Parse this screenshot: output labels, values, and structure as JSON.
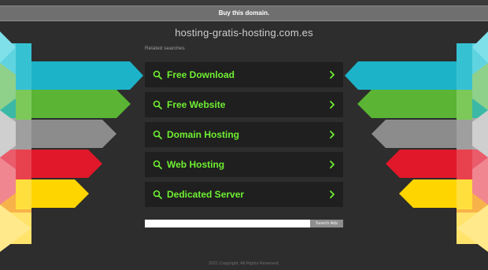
{
  "buy_bar": {
    "label": "Buy this domain."
  },
  "domain": {
    "title": "hosting-gratis-hosting.com.es"
  },
  "related": {
    "label": "Related searches",
    "items": [
      {
        "label": "Free Download"
      },
      {
        "label": "Free Website"
      },
      {
        "label": "Domain Hosting"
      },
      {
        "label": "Web Hosting"
      },
      {
        "label": "Dedicated Server"
      }
    ]
  },
  "search": {
    "value": "",
    "placeholder": "",
    "button_label": "Search Ads"
  },
  "footer": {
    "copyright": "2021 Copyright. All Rights Reserved."
  },
  "colors": {
    "background": "#2d2d2d",
    "link_text": "#6ff032",
    "link_bg": "#1f1f1f",
    "stripe_cyan": "#1cb3c8",
    "stripe_green": "#5bb434",
    "stripe_gray": "#8c8c8c",
    "stripe_red": "#e1182a",
    "stripe_yellow": "#ffd500"
  },
  "icons": {
    "search": "search-icon",
    "chevron": "chevron-right-icon"
  }
}
